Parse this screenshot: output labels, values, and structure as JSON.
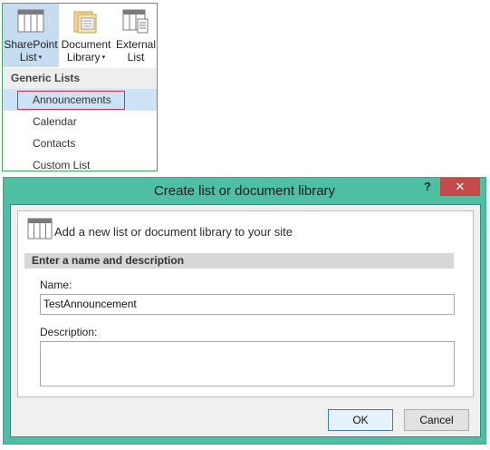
{
  "ribbon": {
    "buttons": [
      {
        "line1": "SharePoint",
        "line2": "List",
        "caret": "▾",
        "icon": "list-grid-icon"
      },
      {
        "line1": "Document",
        "line2": "Library",
        "caret": "▾",
        "icon": "document-library-icon"
      },
      {
        "line1": "External",
        "line2": "List",
        "caret": "",
        "icon": "external-list-icon"
      }
    ],
    "menu_header": "Generic Lists",
    "menu_items": [
      "Announcements",
      "Calendar",
      "Contacts",
      "Custom List"
    ],
    "selected_item": "Announcements"
  },
  "dialog": {
    "title": "Create list or document library",
    "help_label": "?",
    "close_label": "✕",
    "heading": "Add a new list or document library to your site",
    "section": "Enter a name and description",
    "name_label": "Name:",
    "name_value": "TestAnnouncement",
    "description_label": "Description:",
    "description_value": "",
    "ok_label": "OK",
    "cancel_label": "Cancel"
  },
  "colors": {
    "accent_green": "#4aa564",
    "dialog_frame": "#4fbfa4",
    "close_red": "#c74a4a",
    "selection_blue": "#cce3f5",
    "selection_outline": "#c0394b"
  }
}
